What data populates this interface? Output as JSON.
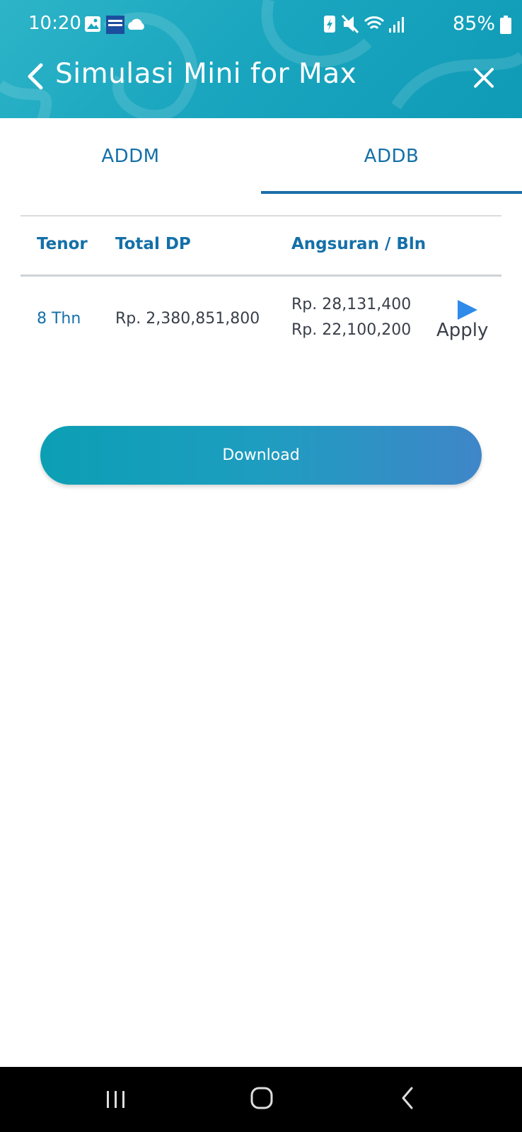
{
  "status_bar": {
    "time": "10:20",
    "battery": "85%",
    "left_icons": [
      "gallery-icon",
      "app-notification-icon",
      "cloud-icon"
    ],
    "right_icons": [
      "battery-saver-icon",
      "mute-icon",
      "wifi-icon",
      "signal-icon",
      "battery-icon"
    ]
  },
  "app_bar": {
    "title": "Simulasi Mini for Max",
    "back_icon": "chevron-left-icon",
    "close_icon": "close-icon"
  },
  "tabs": [
    {
      "label": "ADDM",
      "active": false
    },
    {
      "label": "ADDB",
      "active": true
    }
  ],
  "table": {
    "headers": {
      "tenor": "Tenor",
      "total_dp": "Total DP",
      "angsuran": "Angsuran / Bln"
    },
    "rows": [
      {
        "tenor": "8 Thn",
        "total_dp": "Rp. 2,380,851,800",
        "angsuran_1": "Rp. 28,131,400",
        "angsuran_2": "Rp. 22,100,200",
        "action": "Apply"
      }
    ]
  },
  "download_label": "Download",
  "colors": {
    "header": "#1aa6bf",
    "accent_blue": "#1470a8",
    "apply_icon": "#2e8bea",
    "button_start": "#0b9fb4",
    "button_end": "#3f86c8"
  },
  "nav_bar": [
    "recents-icon",
    "home-icon",
    "back-icon"
  ]
}
